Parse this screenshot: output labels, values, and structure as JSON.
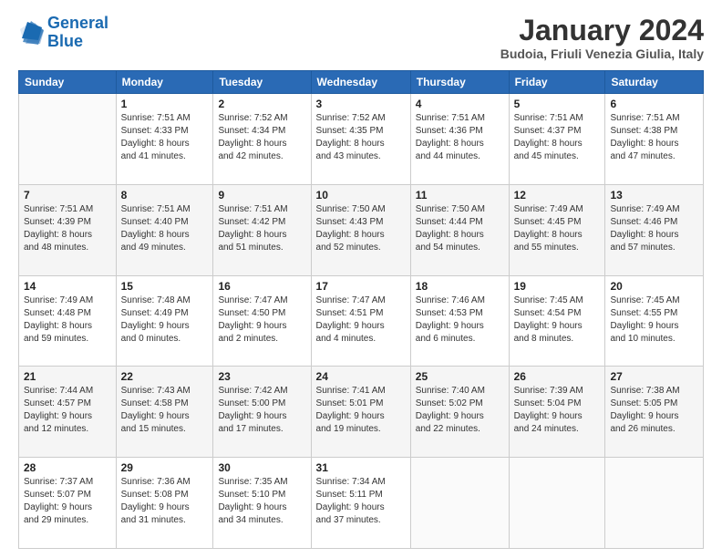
{
  "logo": {
    "line1": "General",
    "line2": "Blue"
  },
  "title": "January 2024",
  "subtitle": "Budoia, Friuli Venezia Giulia, Italy",
  "header_days": [
    "Sunday",
    "Monday",
    "Tuesday",
    "Wednesday",
    "Thursday",
    "Friday",
    "Saturday"
  ],
  "weeks": [
    [
      {
        "day": "",
        "info": ""
      },
      {
        "day": "1",
        "info": "Sunrise: 7:51 AM\nSunset: 4:33 PM\nDaylight: 8 hours\nand 41 minutes."
      },
      {
        "day": "2",
        "info": "Sunrise: 7:52 AM\nSunset: 4:34 PM\nDaylight: 8 hours\nand 42 minutes."
      },
      {
        "day": "3",
        "info": "Sunrise: 7:52 AM\nSunset: 4:35 PM\nDaylight: 8 hours\nand 43 minutes."
      },
      {
        "day": "4",
        "info": "Sunrise: 7:51 AM\nSunset: 4:36 PM\nDaylight: 8 hours\nand 44 minutes."
      },
      {
        "day": "5",
        "info": "Sunrise: 7:51 AM\nSunset: 4:37 PM\nDaylight: 8 hours\nand 45 minutes."
      },
      {
        "day": "6",
        "info": "Sunrise: 7:51 AM\nSunset: 4:38 PM\nDaylight: 8 hours\nand 47 minutes."
      }
    ],
    [
      {
        "day": "7",
        "info": "Sunrise: 7:51 AM\nSunset: 4:39 PM\nDaylight: 8 hours\nand 48 minutes."
      },
      {
        "day": "8",
        "info": "Sunrise: 7:51 AM\nSunset: 4:40 PM\nDaylight: 8 hours\nand 49 minutes."
      },
      {
        "day": "9",
        "info": "Sunrise: 7:51 AM\nSunset: 4:42 PM\nDaylight: 8 hours\nand 51 minutes."
      },
      {
        "day": "10",
        "info": "Sunrise: 7:50 AM\nSunset: 4:43 PM\nDaylight: 8 hours\nand 52 minutes."
      },
      {
        "day": "11",
        "info": "Sunrise: 7:50 AM\nSunset: 4:44 PM\nDaylight: 8 hours\nand 54 minutes."
      },
      {
        "day": "12",
        "info": "Sunrise: 7:49 AM\nSunset: 4:45 PM\nDaylight: 8 hours\nand 55 minutes."
      },
      {
        "day": "13",
        "info": "Sunrise: 7:49 AM\nSunset: 4:46 PM\nDaylight: 8 hours\nand 57 minutes."
      }
    ],
    [
      {
        "day": "14",
        "info": "Sunrise: 7:49 AM\nSunset: 4:48 PM\nDaylight: 8 hours\nand 59 minutes."
      },
      {
        "day": "15",
        "info": "Sunrise: 7:48 AM\nSunset: 4:49 PM\nDaylight: 9 hours\nand 0 minutes."
      },
      {
        "day": "16",
        "info": "Sunrise: 7:47 AM\nSunset: 4:50 PM\nDaylight: 9 hours\nand 2 minutes."
      },
      {
        "day": "17",
        "info": "Sunrise: 7:47 AM\nSunset: 4:51 PM\nDaylight: 9 hours\nand 4 minutes."
      },
      {
        "day": "18",
        "info": "Sunrise: 7:46 AM\nSunset: 4:53 PM\nDaylight: 9 hours\nand 6 minutes."
      },
      {
        "day": "19",
        "info": "Sunrise: 7:45 AM\nSunset: 4:54 PM\nDaylight: 9 hours\nand 8 minutes."
      },
      {
        "day": "20",
        "info": "Sunrise: 7:45 AM\nSunset: 4:55 PM\nDaylight: 9 hours\nand 10 minutes."
      }
    ],
    [
      {
        "day": "21",
        "info": "Sunrise: 7:44 AM\nSunset: 4:57 PM\nDaylight: 9 hours\nand 12 minutes."
      },
      {
        "day": "22",
        "info": "Sunrise: 7:43 AM\nSunset: 4:58 PM\nDaylight: 9 hours\nand 15 minutes."
      },
      {
        "day": "23",
        "info": "Sunrise: 7:42 AM\nSunset: 5:00 PM\nDaylight: 9 hours\nand 17 minutes."
      },
      {
        "day": "24",
        "info": "Sunrise: 7:41 AM\nSunset: 5:01 PM\nDaylight: 9 hours\nand 19 minutes."
      },
      {
        "day": "25",
        "info": "Sunrise: 7:40 AM\nSunset: 5:02 PM\nDaylight: 9 hours\nand 22 minutes."
      },
      {
        "day": "26",
        "info": "Sunrise: 7:39 AM\nSunset: 5:04 PM\nDaylight: 9 hours\nand 24 minutes."
      },
      {
        "day": "27",
        "info": "Sunrise: 7:38 AM\nSunset: 5:05 PM\nDaylight: 9 hours\nand 26 minutes."
      }
    ],
    [
      {
        "day": "28",
        "info": "Sunrise: 7:37 AM\nSunset: 5:07 PM\nDaylight: 9 hours\nand 29 minutes."
      },
      {
        "day": "29",
        "info": "Sunrise: 7:36 AM\nSunset: 5:08 PM\nDaylight: 9 hours\nand 31 minutes."
      },
      {
        "day": "30",
        "info": "Sunrise: 7:35 AM\nSunset: 5:10 PM\nDaylight: 9 hours\nand 34 minutes."
      },
      {
        "day": "31",
        "info": "Sunrise: 7:34 AM\nSunset: 5:11 PM\nDaylight: 9 hours\nand 37 minutes."
      },
      {
        "day": "",
        "info": ""
      },
      {
        "day": "",
        "info": ""
      },
      {
        "day": "",
        "info": ""
      }
    ]
  ]
}
